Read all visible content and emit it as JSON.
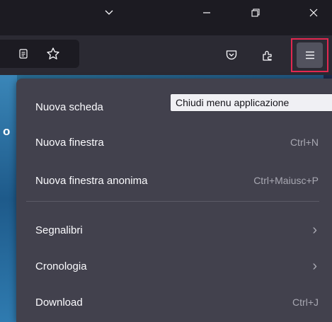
{
  "titlebar": {
    "controls": [
      {
        "name": "chevron-down-icon"
      },
      {
        "name": "minimize-icon"
      },
      {
        "name": "restore-icon"
      },
      {
        "name": "close-icon"
      }
    ]
  },
  "toolbar": {
    "icons": [
      "reader-view-icon",
      "bookmark-star-icon",
      "pocket-icon",
      "extensions-icon",
      "app-menu-icon"
    ]
  },
  "tooltip": "Chiudi menu applicazione",
  "menu": {
    "items": [
      {
        "label": "Nuova scheda",
        "shortcut": ""
      },
      {
        "label": "Nuova finestra",
        "shortcut": "Ctrl+N"
      },
      {
        "label": "Nuova finestra anonima",
        "shortcut": "Ctrl+Maiusc+P"
      },
      {
        "label": "Segnalibri",
        "shortcut": "›"
      },
      {
        "label": "Cronologia",
        "shortcut": "›"
      },
      {
        "label": "Download",
        "shortcut": "Ctrl+J"
      }
    ]
  },
  "page": {
    "fragment": "o"
  },
  "colors": {
    "highlight_border": "#e22850",
    "panel_bg": "#42414d",
    "toolbar_bg": "#2b2a33"
  }
}
